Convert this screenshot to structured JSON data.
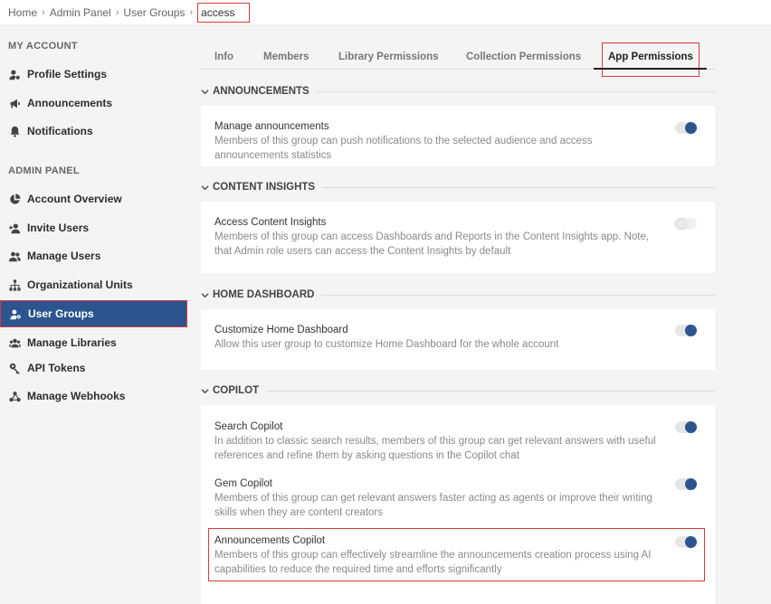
{
  "breadcrumb": {
    "items": [
      "Home",
      "Admin Panel",
      "User Groups"
    ],
    "current": "access"
  },
  "sidebar": {
    "my_account_title": "MY ACCOUNT",
    "my_account_items": [
      {
        "label": "Profile Settings",
        "icon": "profile-settings-icon"
      },
      {
        "label": "Announcements",
        "icon": "megaphone-icon"
      },
      {
        "label": "Notifications",
        "icon": "bell-icon"
      }
    ],
    "admin_title": "ADMIN PANEL",
    "admin_items": [
      {
        "label": "Account Overview",
        "icon": "pie-chart-icon"
      },
      {
        "label": "Invite Users",
        "icon": "add-user-icon"
      },
      {
        "label": "Manage Users",
        "icon": "users-icon"
      },
      {
        "label": "Organizational Units",
        "icon": "org-chart-icon"
      },
      {
        "label": "User Groups",
        "icon": "user-group-icon",
        "active": true
      },
      {
        "label": "Manage Libraries",
        "icon": "libraries-icon"
      },
      {
        "label": "API Tokens",
        "icon": "key-icon"
      },
      {
        "label": "Manage Webhooks",
        "icon": "webhook-icon"
      }
    ]
  },
  "tabs": [
    "Info",
    "Members",
    "Library Permissions",
    "Collection Permissions",
    "App Permissions"
  ],
  "active_tab": "App Permissions",
  "groups": {
    "announcements": {
      "title": "ANNOUNCEMENTS",
      "perms": [
        {
          "title": "Manage announcements",
          "desc": "Members of this group can push notifications to the selected audience and access announcements statistics",
          "enabled": true
        }
      ]
    },
    "content_insights": {
      "title": "CONTENT INSIGHTS",
      "perms": [
        {
          "title": "Access Content Insights",
          "desc": "Members of this group can access Dashboards and Reports in the Content Insights app. Note, that Admin role users can access the Content Insights by default",
          "enabled": false
        }
      ]
    },
    "home_dashboard": {
      "title": "HOME DASHBOARD",
      "perms": [
        {
          "title": "Customize Home Dashboard",
          "desc": "Allow this user group to customize Home Dashboard for the whole account",
          "enabled": true
        }
      ]
    },
    "copilot": {
      "title": "COPILOT",
      "perms": [
        {
          "title": "Search Copilot",
          "desc": "In addition to classic search results, members of this group can get relevant answers with useful references and refine them by asking questions in the Copilot chat",
          "enabled": true
        },
        {
          "title": "Gem Copilot",
          "desc": "Members of this group can get relevant answers faster acting as agents or improve their writing skills when they are content creators",
          "enabled": true
        },
        {
          "title": "Announcements Copilot",
          "desc": "Members of this group can effectively streamline the announcements creation process using AI capabilities to reduce the required time and efforts significantly",
          "enabled": true
        }
      ]
    }
  },
  "colors": {
    "accent": "#2c5590",
    "highlight": "#d9393c"
  }
}
